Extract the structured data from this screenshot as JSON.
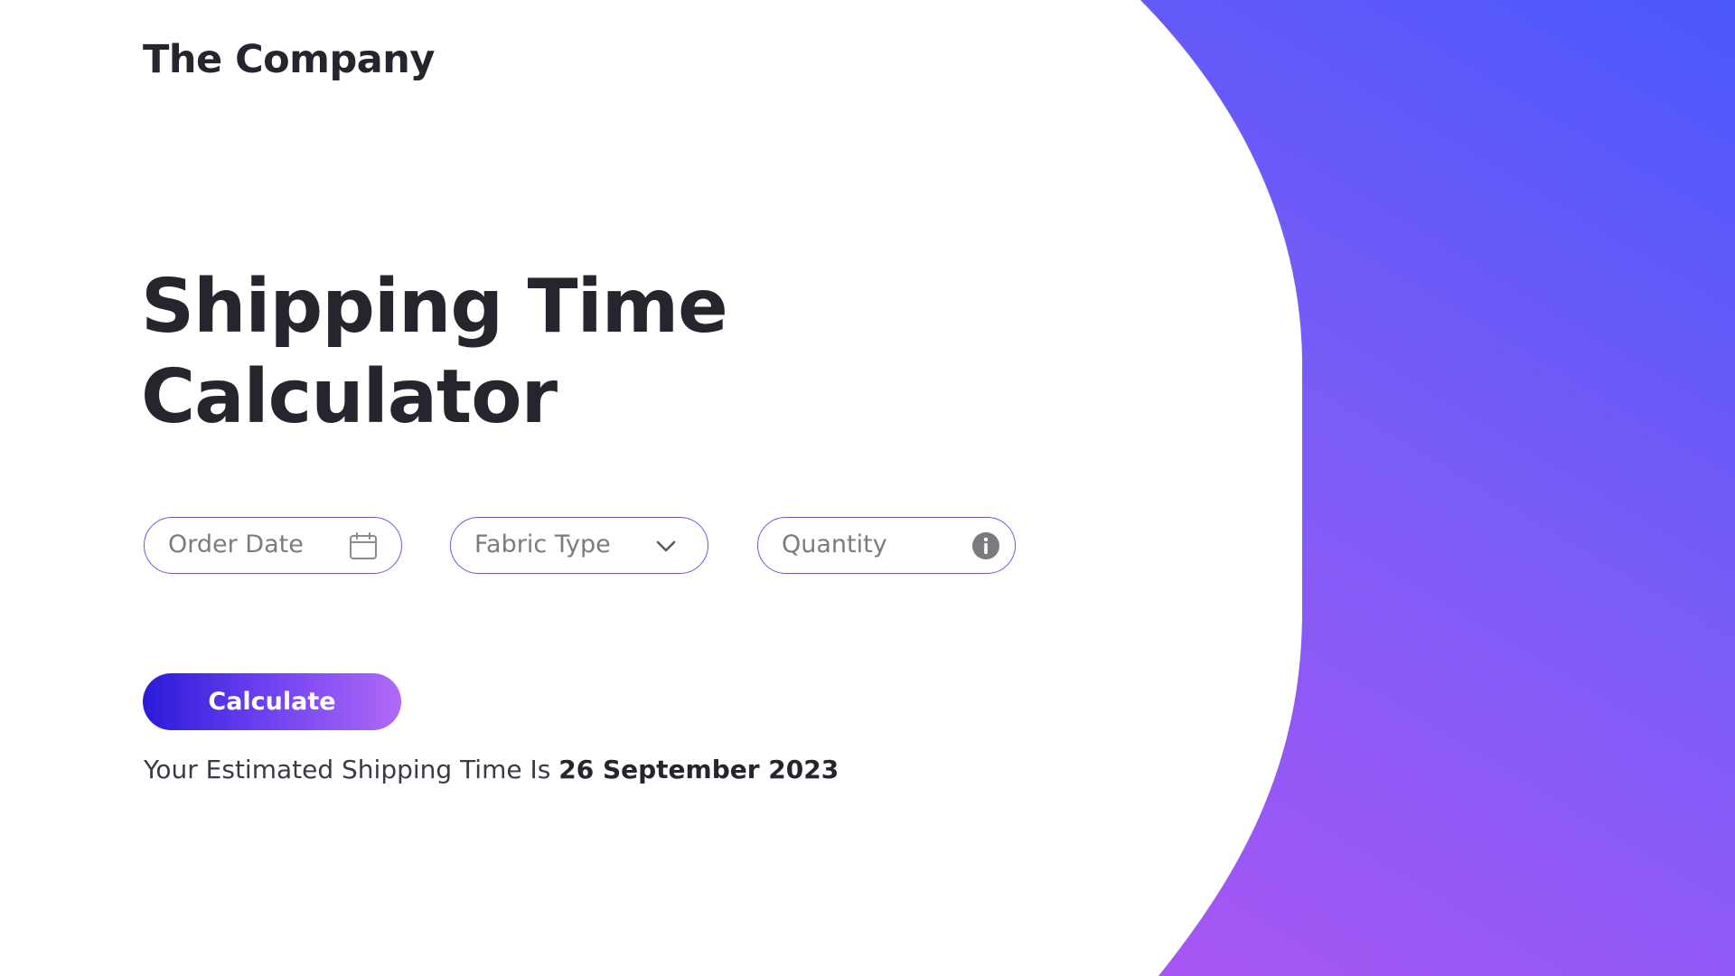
{
  "header": {
    "brand": "The Company"
  },
  "hero": {
    "title_line1": "Shipping Time",
    "title_line2": "Calculator"
  },
  "form": {
    "order_date": {
      "placeholder": "Order Date",
      "icon": "calendar-icon"
    },
    "fabric_type": {
      "placeholder": "Fabric Type",
      "icon": "chevron-down-icon"
    },
    "quantity": {
      "placeholder": "Quantity",
      "icon": "info-icon"
    },
    "calculate_label": "Calculate"
  },
  "result": {
    "prefix": "Your Estimated Shipping Time Is",
    "date": "26 September 2023"
  },
  "colors": {
    "text_dark": "#24252d",
    "placeholder": "#7b7b80",
    "field_border": "#6f56e0",
    "button_gradient_start": "#2a1ad8",
    "button_gradient_end": "#b06af7",
    "background_gradient_start": "#4a57fb",
    "background_gradient_end": "#a856f4"
  }
}
